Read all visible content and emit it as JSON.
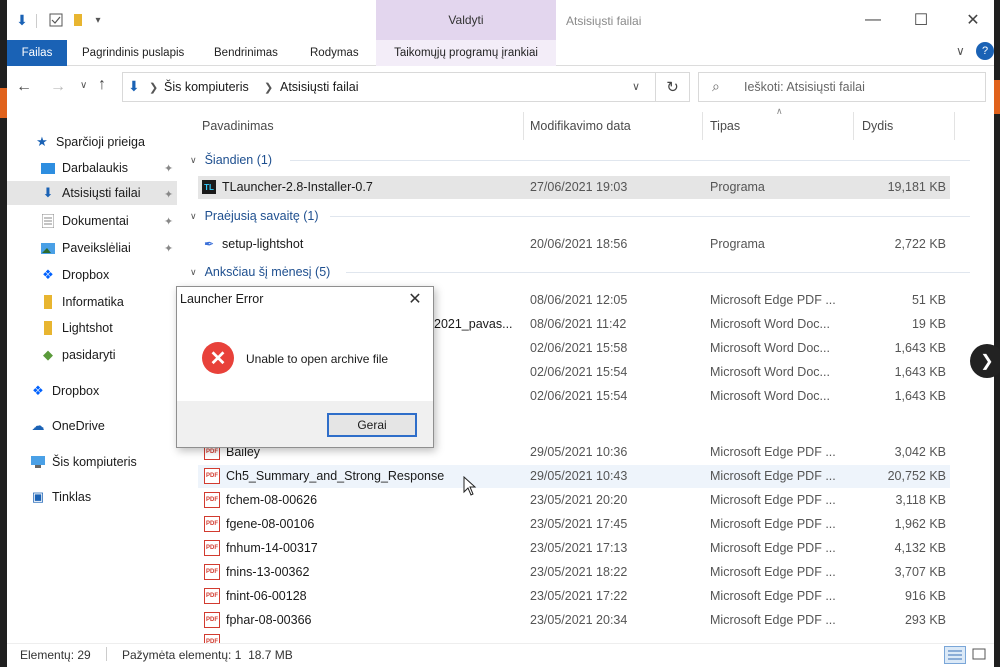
{
  "window": {
    "title": "Atsisiųsti failai",
    "context_tab": "Valdyti"
  },
  "ribbon": {
    "tabs": [
      "Failas",
      "Pagrindinis puslapis",
      "Bendrinimas",
      "Rodymas",
      "Taikomųjų programų įrankiai"
    ]
  },
  "address": {
    "crumbs": [
      "Šis kompiuteris",
      "Atsisiųsti failai"
    ],
    "search_placeholder": "Ieškoti: Atsisiųsti failai"
  },
  "sidebar": {
    "items": [
      {
        "label": "Sparčioji prieiga",
        "icon": "star-icon"
      },
      {
        "label": "Darbalaukis",
        "icon": "desktop-icon"
      },
      {
        "label": "Atsisiųsti failai",
        "icon": "download-icon"
      },
      {
        "label": "Dokumentai",
        "icon": "documents-icon"
      },
      {
        "label": "Paveikslėliai",
        "icon": "pictures-icon"
      },
      {
        "label": "Dropbox",
        "icon": "dropbox-icon"
      },
      {
        "label": "Informatika",
        "icon": "folder-icon"
      },
      {
        "label": "Lightshot",
        "icon": "folder-icon"
      },
      {
        "label": "pasidaryti",
        "icon": "folder-icon"
      },
      {
        "label": "Dropbox",
        "icon": "dropbox-icon"
      },
      {
        "label": "OneDrive",
        "icon": "onedrive-icon"
      },
      {
        "label": "Šis kompiuteris",
        "icon": "computer-icon"
      },
      {
        "label": "Tinklas",
        "icon": "network-icon"
      }
    ]
  },
  "columns": {
    "name": "Pavadinimas",
    "date": "Modifikavimo data",
    "type": "Tipas",
    "size": "Dydis"
  },
  "groups": [
    {
      "label": "Šiandien (1)"
    },
    {
      "label": "Praėjusią savaitę (1)"
    },
    {
      "label": "Anksčiau šį mėnesį (5)"
    }
  ],
  "files": [
    {
      "name": "TLauncher-2.8-Installer-0.7",
      "date": "27/06/2021 19:03",
      "type": "Programa",
      "size": "19,181 KB"
    },
    {
      "name": "setup-lightshot",
      "date": "20/06/2021 18:56",
      "type": "Programa",
      "size": "2,722 KB"
    },
    {
      "name": "",
      "date": "08/06/2021 12:05",
      "type": "Microsoft Edge PDF ...",
      "size": "51 KB"
    },
    {
      "name": "2021_pavas...",
      "date": "08/06/2021 11:42",
      "type": "Microsoft Word Doc...",
      "size": "19 KB"
    },
    {
      "name": "",
      "date": "02/06/2021 15:58",
      "type": "Microsoft Word Doc...",
      "size": "1,643 KB"
    },
    {
      "name": "",
      "date": "02/06/2021 15:54",
      "type": "Microsoft Word Doc...",
      "size": "1,643 KB"
    },
    {
      "name": "",
      "date": "02/06/2021 15:54",
      "type": "Microsoft Word Doc...",
      "size": "1,643 KB"
    },
    {
      "name": "Bailey",
      "date": "29/05/2021 10:36",
      "type": "Microsoft Edge PDF ...",
      "size": "3,042 KB"
    },
    {
      "name": "Ch5_Summary_and_Strong_Response",
      "date": "29/05/2021 10:43",
      "type": "Microsoft Edge PDF ...",
      "size": "20,752 KB"
    },
    {
      "name": "fchem-08-00626",
      "date": "23/05/2021 20:20",
      "type": "Microsoft Edge PDF ...",
      "size": "3,118 KB"
    },
    {
      "name": "fgene-08-00106",
      "date": "23/05/2021 17:45",
      "type": "Microsoft Edge PDF ...",
      "size": "1,962 KB"
    },
    {
      "name": "fnhum-14-00317",
      "date": "23/05/2021 17:13",
      "type": "Microsoft Edge PDF ...",
      "size": "4,132 KB"
    },
    {
      "name": "fnins-13-00362",
      "date": "23/05/2021 18:22",
      "type": "Microsoft Edge PDF ...",
      "size": "3,707 KB"
    },
    {
      "name": "fnint-06-00128",
      "date": "23/05/2021 17:22",
      "type": "Microsoft Edge PDF ...",
      "size": "916 KB"
    },
    {
      "name": "fphar-08-00366",
      "date": "23/05/2021 20:34",
      "type": "Microsoft Edge PDF ...",
      "size": "293 KB"
    }
  ],
  "dialog": {
    "title": "Launcher Error",
    "message": "Unable to open archive file",
    "ok_label": "Gerai"
  },
  "status": {
    "count": "Elementų: 29",
    "selected": "Pažymėta elementų: 1  18.7 MB"
  },
  "colors": {
    "accent": "#1a62b5",
    "context_tab": "#e3d6ee",
    "selection": "#e5e5e5",
    "error": "#e8413a"
  }
}
